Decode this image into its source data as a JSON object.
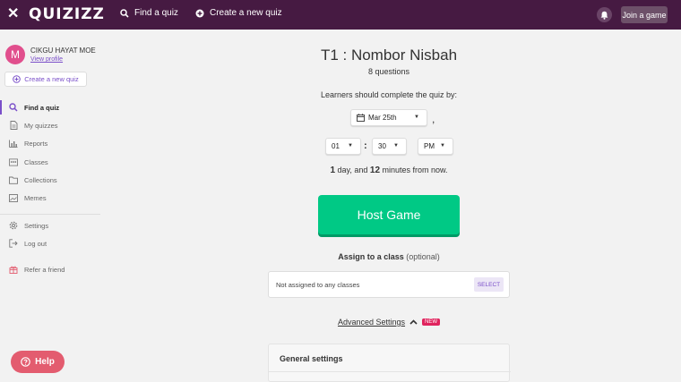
{
  "topbar": {
    "logo": "QUIZIZZ",
    "find_quiz": "Find a quiz",
    "create_quiz": "Create a new quiz",
    "join_game": "Join a game"
  },
  "sidebar": {
    "avatar_letter": "M",
    "user_name": "CIKGU HAYAT MOE",
    "view_profile": "View profile",
    "create_button": "Create a new quiz",
    "items": [
      {
        "label": "Find a quiz",
        "icon": "search-icon",
        "active": true
      },
      {
        "label": "My quizzes",
        "icon": "document-icon"
      },
      {
        "label": "Reports",
        "icon": "chart-icon"
      },
      {
        "label": "Classes",
        "icon": "classes-icon"
      },
      {
        "label": "Collections",
        "icon": "folder-icon"
      },
      {
        "label": "Memes",
        "icon": "image-icon"
      },
      {
        "label": "Settings",
        "icon": "gear-icon"
      },
      {
        "label": "Log out",
        "icon": "logout-icon"
      },
      {
        "label": "Refer a friend",
        "icon": "gift-icon"
      }
    ],
    "help": "Help"
  },
  "main": {
    "title": "T1 : Nombor Nisbah",
    "question_count": "8 questions",
    "complete_by": "Learners should complete the quiz by:",
    "date": "Mar 25th",
    "comma": ",",
    "hour": "01",
    "minute": "30",
    "ampm": "PM",
    "colon": ":",
    "time_from": {
      "days": "1",
      "mid": " day, and ",
      "minutes": "12",
      "suffix": " minutes from now."
    },
    "host_button": "Host Game",
    "assign_title": "Assign to a class",
    "assign_optional": "(optional)",
    "assign_placeholder": "Not assigned to any classes",
    "select_button": "SELECT",
    "advanced_settings": "Advanced Settings",
    "new_badge": "NEW",
    "general_settings": "General settings"
  },
  "colors": {
    "topbar": "#461a42",
    "accent": "#7a4fc9",
    "host_button": "#00c985",
    "help_button": "#e35c6f",
    "avatar": "#e14f8d"
  }
}
